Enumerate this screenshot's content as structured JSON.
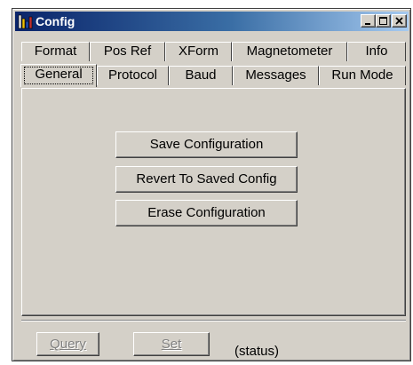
{
  "window": {
    "title": "Config",
    "controls": [
      "minimize-icon",
      "maximize-icon",
      "close-icon"
    ]
  },
  "tabs": {
    "row_top": [
      "Format",
      "Pos Ref",
      "XForm",
      "Magnetometer",
      "Info"
    ],
    "row_bottom": [
      "General",
      "Protocol",
      "Baud",
      "Messages",
      "Run Mode"
    ],
    "active": "General"
  },
  "general": {
    "save_label": "Save Configuration",
    "revert_label": "Revert To Saved Config",
    "erase_label": "Erase Configuration"
  },
  "footer": {
    "query_label": "Query",
    "set_label": "Set",
    "status_text": "(status)"
  }
}
